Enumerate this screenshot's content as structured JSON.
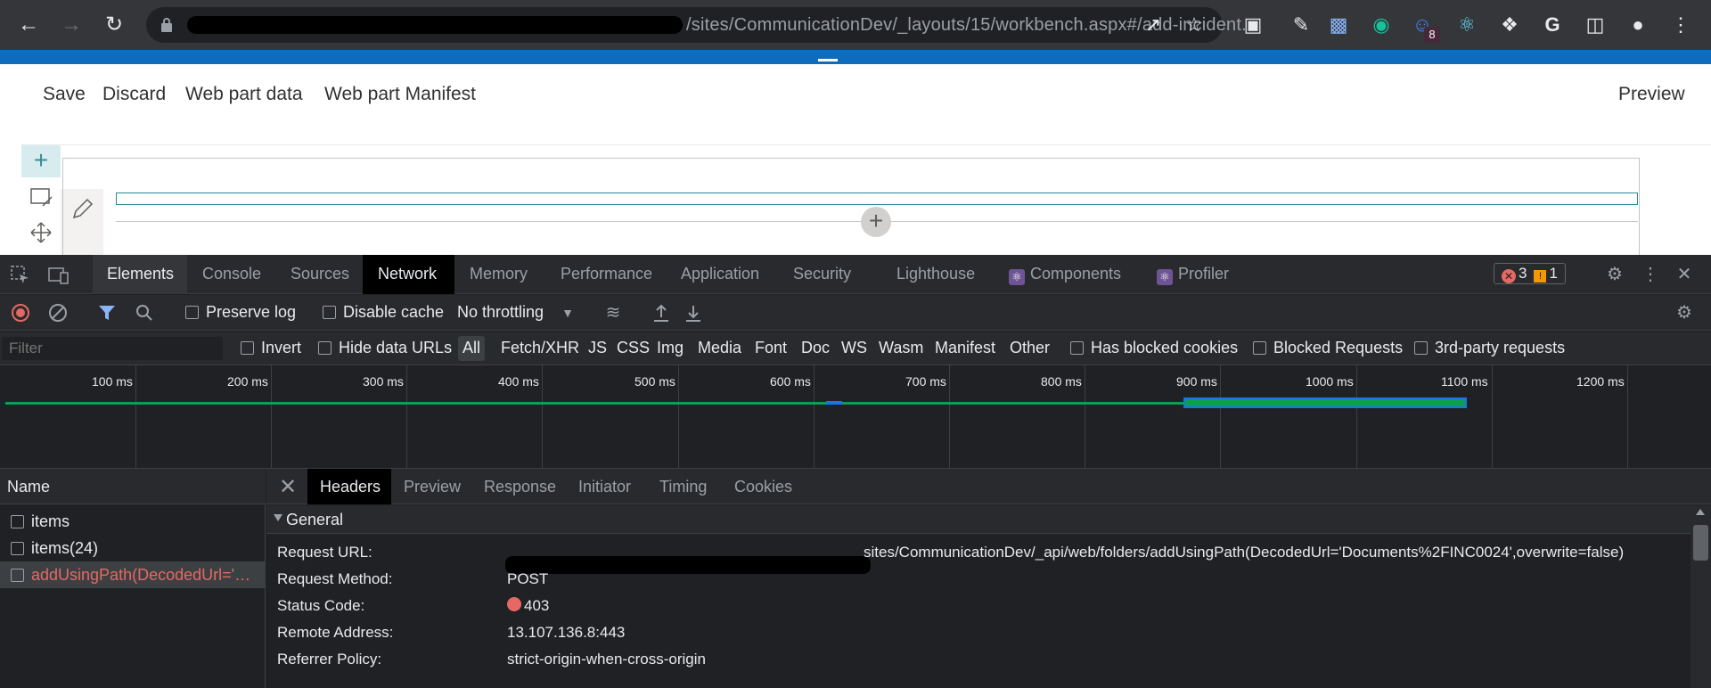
{
  "browser": {
    "url_visible": "/sites/CommunicationDev/_layouts/15/workbench.aspx#/add-incident...",
    "extension_badge": "8"
  },
  "workbench": {
    "commands": [
      "Save",
      "Discard",
      "Web part data",
      "Web part Manifest"
    ],
    "preview_label": "Preview"
  },
  "devtools": {
    "tabs": [
      "Elements",
      "Console",
      "Sources",
      "Network",
      "Memory",
      "Performance",
      "Application",
      "Security",
      "Lighthouse",
      "Components",
      "Profiler"
    ],
    "selected_tab": "Network",
    "error_count": "3",
    "warning_count": "1",
    "toolbar": {
      "preserve_log": "Preserve log",
      "disable_cache": "Disable cache",
      "throttling": "No throttling"
    },
    "filter": {
      "placeholder": "Filter",
      "invert": "Invert",
      "hide_data_urls": "Hide data URLs",
      "types": [
        "All",
        "Fetch/XHR",
        "JS",
        "CSS",
        "Img",
        "Media",
        "Font",
        "Doc",
        "WS",
        "Wasm",
        "Manifest",
        "Other"
      ],
      "has_blocked_cookies": "Has blocked cookies",
      "blocked_requests": "Blocked Requests",
      "third_party": "3rd-party requests"
    },
    "timeline_ticks": [
      "100 ms",
      "200 ms",
      "300 ms",
      "400 ms",
      "500 ms",
      "600 ms",
      "700 ms",
      "800 ms",
      "900 ms",
      "1000 ms",
      "1100 ms",
      "1200 ms"
    ],
    "name_header": "Name",
    "requests": [
      {
        "name": "items",
        "error": false
      },
      {
        "name": "items(24)",
        "error": false
      },
      {
        "name": "addUsingPath(DecodedUrl='Documents%2FINC0024',overwrite=false)",
        "error": true
      }
    ],
    "detail_tabs": [
      "Headers",
      "Preview",
      "Response",
      "Initiator",
      "Timing",
      "Cookies"
    ],
    "general": {
      "label": "General",
      "request_url_key": "Request URL:",
      "request_url_val": "sites/CommunicationDev/_api/web/folders/addUsingPath(DecodedUrl='Documents%2FINC0024',overwrite=false)",
      "request_method_key": "Request Method:",
      "request_method_val": "POST",
      "status_code_key": "Status Code:",
      "status_code_val": "403",
      "remote_address_key": "Remote Address:",
      "remote_address_val": "13.107.136.8:443",
      "referrer_policy_key": "Referrer Policy:",
      "referrer_policy_val": "strict-origin-when-cross-origin"
    }
  }
}
